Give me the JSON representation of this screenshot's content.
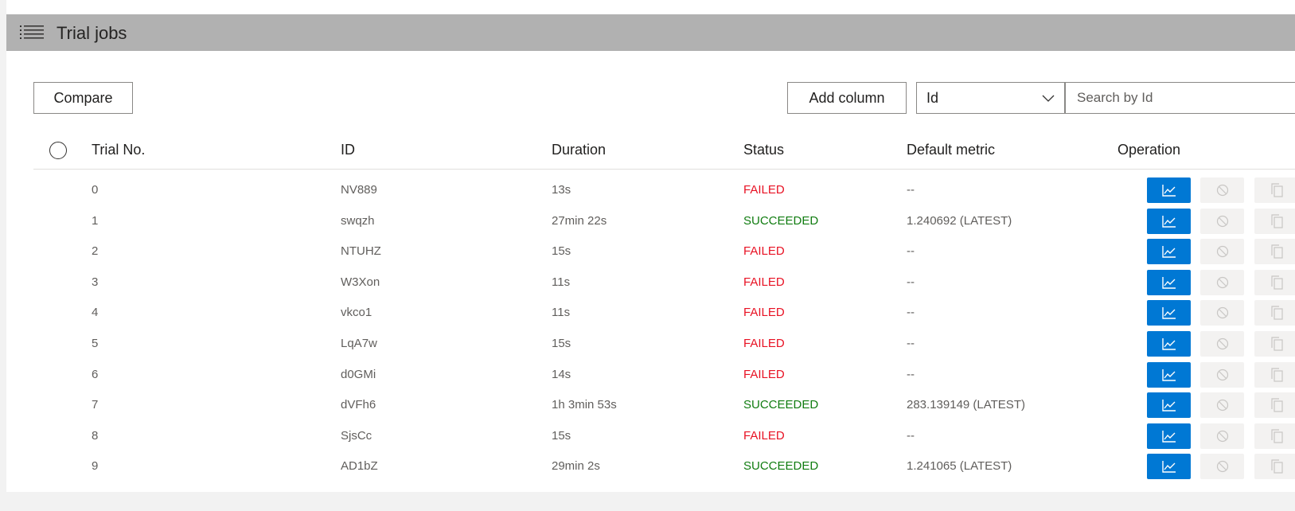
{
  "panel": {
    "title": "Trial jobs",
    "title_icon": "list-icon"
  },
  "toolbar": {
    "compare_label": "Compare",
    "add_column_label": "Add column",
    "search_field_selected": "Id",
    "search_placeholder": "Search by Id"
  },
  "table": {
    "columns": [
      "Trial No.",
      "ID",
      "Duration",
      "Status",
      "Default metric",
      "Operation"
    ],
    "rows": [
      {
        "trial_no": "0",
        "id": "NV889",
        "duration": "13s",
        "status": "FAILED",
        "metric": "--"
      },
      {
        "trial_no": "1",
        "id": "swqzh",
        "duration": "27min 22s",
        "status": "SUCCEEDED",
        "metric": "1.240692 (LATEST)"
      },
      {
        "trial_no": "2",
        "id": "NTUHZ",
        "duration": "15s",
        "status": "FAILED",
        "metric": "--"
      },
      {
        "trial_no": "3",
        "id": "W3Xon",
        "duration": "11s",
        "status": "FAILED",
        "metric": "--"
      },
      {
        "trial_no": "4",
        "id": "vkco1",
        "duration": "11s",
        "status": "FAILED",
        "metric": "--"
      },
      {
        "trial_no": "5",
        "id": "LqA7w",
        "duration": "15s",
        "status": "FAILED",
        "metric": "--"
      },
      {
        "trial_no": "6",
        "id": "d0GMi",
        "duration": "14s",
        "status": "FAILED",
        "metric": "--"
      },
      {
        "trial_no": "7",
        "id": "dVFh6",
        "duration": "1h 3min 53s",
        "status": "SUCCEEDED",
        "metric": "283.139149 (LATEST)"
      },
      {
        "trial_no": "8",
        "id": "SjsCc",
        "duration": "15s",
        "status": "FAILED",
        "metric": "--"
      },
      {
        "trial_no": "9",
        "id": "AD1bZ",
        "duration": "29min 2s",
        "status": "SUCCEEDED",
        "metric": "1.241065 (LATEST)"
      }
    ]
  },
  "operation_icons": [
    "chart-line-icon",
    "cancel-icon",
    "copy-icon"
  ],
  "colors": {
    "header_bar": "#b1b1b1",
    "primary": "#0078d4",
    "failed": "#e81123",
    "succeeded": "#107c10",
    "disabled_button": "#f3f2f1"
  }
}
